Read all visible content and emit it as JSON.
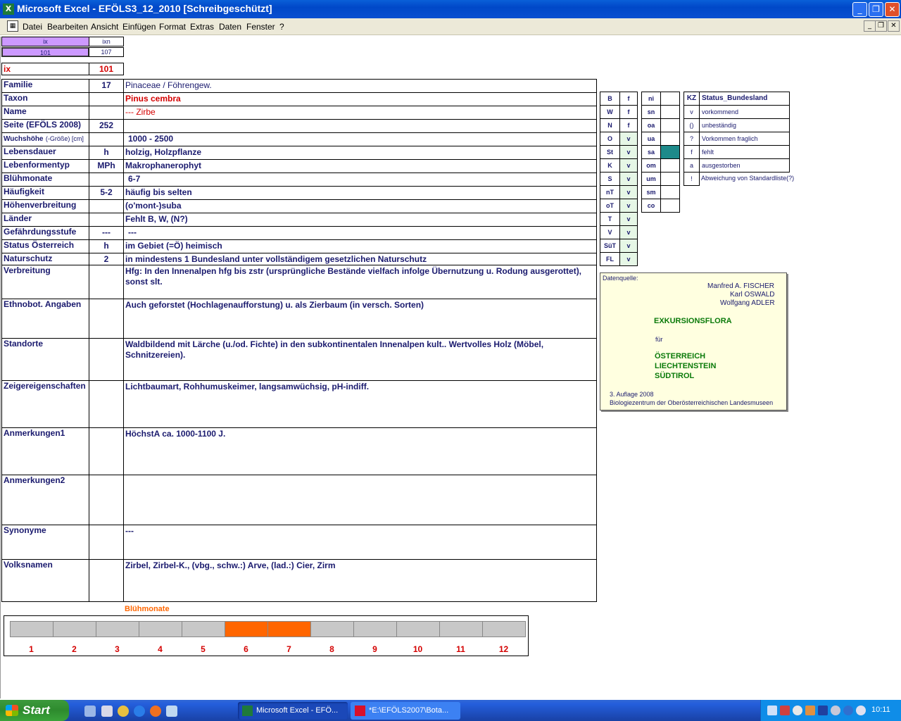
{
  "window": {
    "title": "Microsoft Excel - EFÖLS3_12_2010  [Schreibgeschützt]",
    "minimize": "_",
    "restore": "❐",
    "close": "✕"
  },
  "menu": {
    "items": [
      "Datei",
      "Bearbeiten",
      "Ansicht",
      "Einfügen",
      "Format",
      "Extras",
      "Daten",
      "Fenster",
      "?"
    ],
    "doc_min": "_",
    "doc_restore": "❐",
    "doc_close": "✕"
  },
  "index": {
    "ix_label": "ix",
    "ixn_label": "ixn",
    "ix_value": "101",
    "ixn_value": "107",
    "ix_row_label": "ix",
    "ix_row_value": "101"
  },
  "rows": [
    {
      "label": "Familie",
      "code": "17",
      "value": "Pinaceae / Föhrengew."
    },
    {
      "label": "Taxon",
      "code": "",
      "value": "Pinus cembra"
    },
    {
      "label": "Name",
      "code": "",
      "value": "--- Zirbe"
    },
    {
      "label": "Seite (EFÖLS 2008)",
      "code": "252",
      "value": ""
    },
    {
      "label": "Wuchshöhe",
      "label_extra": "(-Größe) [cm]",
      "code": "",
      "value": "1000 - 2500"
    },
    {
      "label": "Lebensdauer",
      "code": "h",
      "value": "holzig, Holzpflanze"
    },
    {
      "label": "Lebenformentyp",
      "code": "MPh",
      "value": "Makrophanerophyt"
    },
    {
      "label": "Blühmonate",
      "code": "",
      "value": "6-7"
    },
    {
      "label": "Häufigkeit",
      "code": "5-2",
      "value": "häufig bis selten"
    },
    {
      "label": "Höhenverbreitung",
      "code": "",
      "value": "(o'mont-)suba"
    },
    {
      "label": "Länder",
      "code": "",
      "value": "Fehlt B, W, (N?)"
    },
    {
      "label": "Gefährdungsstufe",
      "code": "---",
      "value": "---"
    },
    {
      "label": "Status Österreich",
      "code": "h",
      "value": "im Gebiet (=Ö) heimisch"
    },
    {
      "label": "Naturschutz",
      "code": "2",
      "value": "in mindestens 1 Bundesland unter vollständigem gesetzlichen Naturschutz"
    },
    {
      "label": "Verbreitung",
      "code": "",
      "value": "Hfg: In den Innenalpen hfg bis zstr (ursprüngliche Bestände vielfach infolge Übernutzung u. Rodung ausgerottet), sonst slt."
    },
    {
      "label": "Ethnobot. Angaben",
      "code": "",
      "value": "Auch geforstet (Hochlagenaufforstung) u. als Zierbaum (in versch. Sorten)"
    },
    {
      "label": "Standorte",
      "code": "",
      "value": "Waldbildend mit Lärche (u./od. Fichte) in den subkontinentalen Innenalpen kult.. Wertvolles Holz (Möbel, Schnitzereien)."
    },
    {
      "label": "Zeigereigenschaften",
      "code": "",
      "value": "Lichtbaumart, Rohhumuskeimer, langsamwüchsig, pH-indiff."
    },
    {
      "label": "Anmerkungen1",
      "code": "",
      "value": "HöchstA ca. 1000-1100 J."
    },
    {
      "label": "Anmerkungen2",
      "code": "",
      "value": ""
    },
    {
      "label": "Synonyme",
      "code": "",
      "value": "---"
    },
    {
      "label": "Volksnamen",
      "code": "",
      "value": "Zirbel, Zirbel-K., (vbg., schw.:) Arve, (lad.:) Cier, Zirm"
    }
  ],
  "states_left": [
    {
      "code": "B",
      "status": "f"
    },
    {
      "code": "W",
      "status": "f"
    },
    {
      "code": "N",
      "status": "f"
    },
    {
      "code": "O",
      "status": "v"
    },
    {
      "code": "St",
      "status": "v"
    },
    {
      "code": "K",
      "status": "v"
    },
    {
      "code": "S",
      "status": "v"
    },
    {
      "code": "nT",
      "status": "v"
    },
    {
      "code": "oT",
      "status": "v"
    },
    {
      "code": "T",
      "status": "v"
    },
    {
      "code": "V",
      "status": "v"
    },
    {
      "code": "SüT",
      "status": "v"
    },
    {
      "code": "FL",
      "status": "v"
    }
  ],
  "states_right": [
    {
      "code": "ni",
      "status": ""
    },
    {
      "code": "sn",
      "status": ""
    },
    {
      "code": "oa",
      "status": ""
    },
    {
      "code": "ua",
      "status": ""
    },
    {
      "code": "sa",
      "status": ""
    },
    {
      "code": "om",
      "status": ""
    },
    {
      "code": "um",
      "status": ""
    },
    {
      "code": "sm",
      "status": ""
    },
    {
      "code": "co",
      "status": ""
    }
  ],
  "legend": {
    "header_kz": "KZ",
    "header_status": "Status_Bundesland",
    "items": [
      {
        "kz": "v",
        "text": "vorkommend"
      },
      {
        "kz": "()",
        "text": "unbeständig"
      },
      {
        "kz": "?",
        "text": "Vorkommen fraglich"
      },
      {
        "kz": "f",
        "text": "fehlt"
      },
      {
        "kz": "a",
        "text": "ausgestorben"
      },
      {
        "kz": "!",
        "text": "Abweichung von Standardliste(?)"
      }
    ]
  },
  "source": {
    "label": "Datenquelle:",
    "authors": [
      "Manfred A. FISCHER",
      "Karl OSWALD",
      "Wolfgang ADLER"
    ],
    "title": "EXKURSIONSFLORA",
    "fuer": "für",
    "regions": [
      "ÖSTERREICH",
      "LIECHTENSTEIN",
      "SÜDTIROL"
    ],
    "edition": "3. Auflage 2008",
    "publisher": "Biologiezentrum der Oberösterreichischen Landesmuseen"
  },
  "bloom": {
    "title": "Blühmonate",
    "months": [
      "1",
      "2",
      "3",
      "4",
      "5",
      "6",
      "7",
      "8",
      "9",
      "10",
      "11",
      "12"
    ],
    "active_months": [
      6,
      7
    ],
    "active_color": "#ff6600",
    "inactive_color": "#c8c8c8"
  },
  "taskbar": {
    "start": "Start",
    "tasks": [
      "Microsoft Excel - EFÖ...",
      "*E:\\EFÖLS2007\\Bota..."
    ],
    "clock": "10:11"
  }
}
